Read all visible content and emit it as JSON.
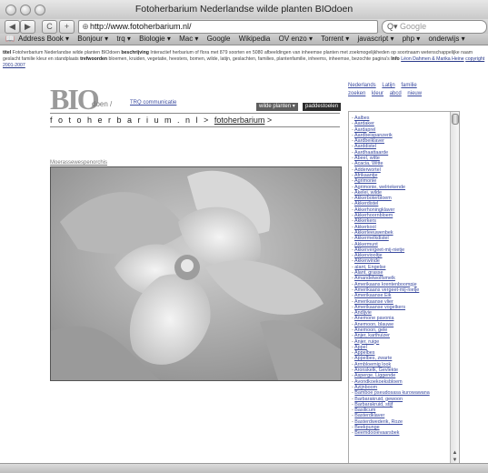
{
  "window": {
    "title": "Fotoherbarium Nederlandse wilde planten BIOdoen"
  },
  "toolbar": {
    "back_label": "◀",
    "forward_label": "▶",
    "reload_label": "C",
    "add_label": "+",
    "url": "http://www.fotoherbarium.nl/",
    "search_placeholder": "Google",
    "search_icon": "Q▾"
  },
  "bookmarks": [
    "Address Book ▾",
    "Bonjour ▾",
    "trq ▾",
    "Biologie ▾",
    "Mac ▾",
    "Google",
    "Wikipedia",
    "OV enzo ▾",
    "Torrent ▾",
    "javascript ▾",
    "php ▾",
    "onderwijs ▾"
  ],
  "description": {
    "label": "titel",
    "text": "Fotoherbarium Nederlandse wilde planten BIOdoen",
    "beschrijving_label": "beschrijving",
    "beschrijving_text": "Interactief herbarium of flora met 879 soorten en 5080 afbeeldingen van inheemse planten met zoekmogelijkheden op soortnaam wetenschappelijke naam geslacht familie kleur en standplaats",
    "trefwoorden_label": "trefwoorden",
    "trefwoorden_text": "bloemen, kruiden, vegetatie, heesters, bomen, wilde, latijn, geslachten, families, plantenfamilie, inheems, inheemse, bezochte pagina's",
    "info_label": "Info",
    "authors": "Léon Dahmen & Marika Heine",
    "copyright": "copyright 2001-2007"
  },
  "header": {
    "logo": "BIO",
    "logo_suffix": "doen /",
    "trq_link": "TRQ communicatie",
    "nav_wild": "wilde planten ▾",
    "nav_padde": "paddestoelen",
    "breadcrumb_site": "f o t o h e r b a r i u m . n l",
    "breadcrumb_sep": " > ",
    "breadcrumb_link": "fotoherbarium",
    "breadcrumb_end": " >"
  },
  "sitelinks": {
    "row1": [
      "Nederlands",
      "Latijn",
      "familie"
    ],
    "row2": [
      "zoeken",
      "kleur",
      "abcd",
      "nieuw"
    ]
  },
  "photo": {
    "caption": "Moerassewespenorchis"
  },
  "plant_list": [
    "Aalbes",
    "Aardaker",
    "Aardaprel",
    "Aardbeispanzerik",
    "Aardbeiklaver",
    "Aarddistel",
    "Aardhaattaarde",
    "Abeel, witte",
    "Acacia, Witte",
    "Adderwortel",
    "Afrikaantje",
    "Agrimonie",
    "Agrimonie, welriekende",
    "Akelei, wilde",
    "Akkerboterbloem",
    "Akkerdistel",
    "Akkerhoningklaver",
    "Akkerhoornbloem",
    "Akkerkers",
    "Akkerkool",
    "Akkerleeuwenbek",
    "Akkermelkdistel",
    "Akkermunt",
    "Akkervergeet-mij-nietje",
    "Akkerviooltje",
    "Akkerwinde",
    "alant, Engelse",
    "Alant, grasse",
    "Amandelwolfsmelk",
    "Amerikaans krentenboompje",
    "Amerikaans vergeet-mij-nietje",
    "Amerikaanse Eik",
    "Amerikaanse vlier",
    "Amerikaanse vogelkers",
    "Andijvie",
    "Anemone pavonia",
    "Anemoon, blauwe",
    "Anemoon, gele",
    "Anjer, karthuizer",
    "Anjer, ruige",
    "Appel",
    "Appelbes",
    "Appelbes, zwarte",
    "Armbloemig look",
    "Aronskelk, Gevlekte",
    "Asperge, Liggende",
    "Avondkoekoeksbloem",
    "Azijnboom",
    "Bamboe pseudosasa kurowawana",
    "Barbarakruid, gewoon",
    "Barbarakruid, stijf",
    "Basilicum",
    "Basterdklaver",
    "Basterdwederik, Roze",
    "Beekpunge",
    "Beemdooievaarsbek"
  ]
}
